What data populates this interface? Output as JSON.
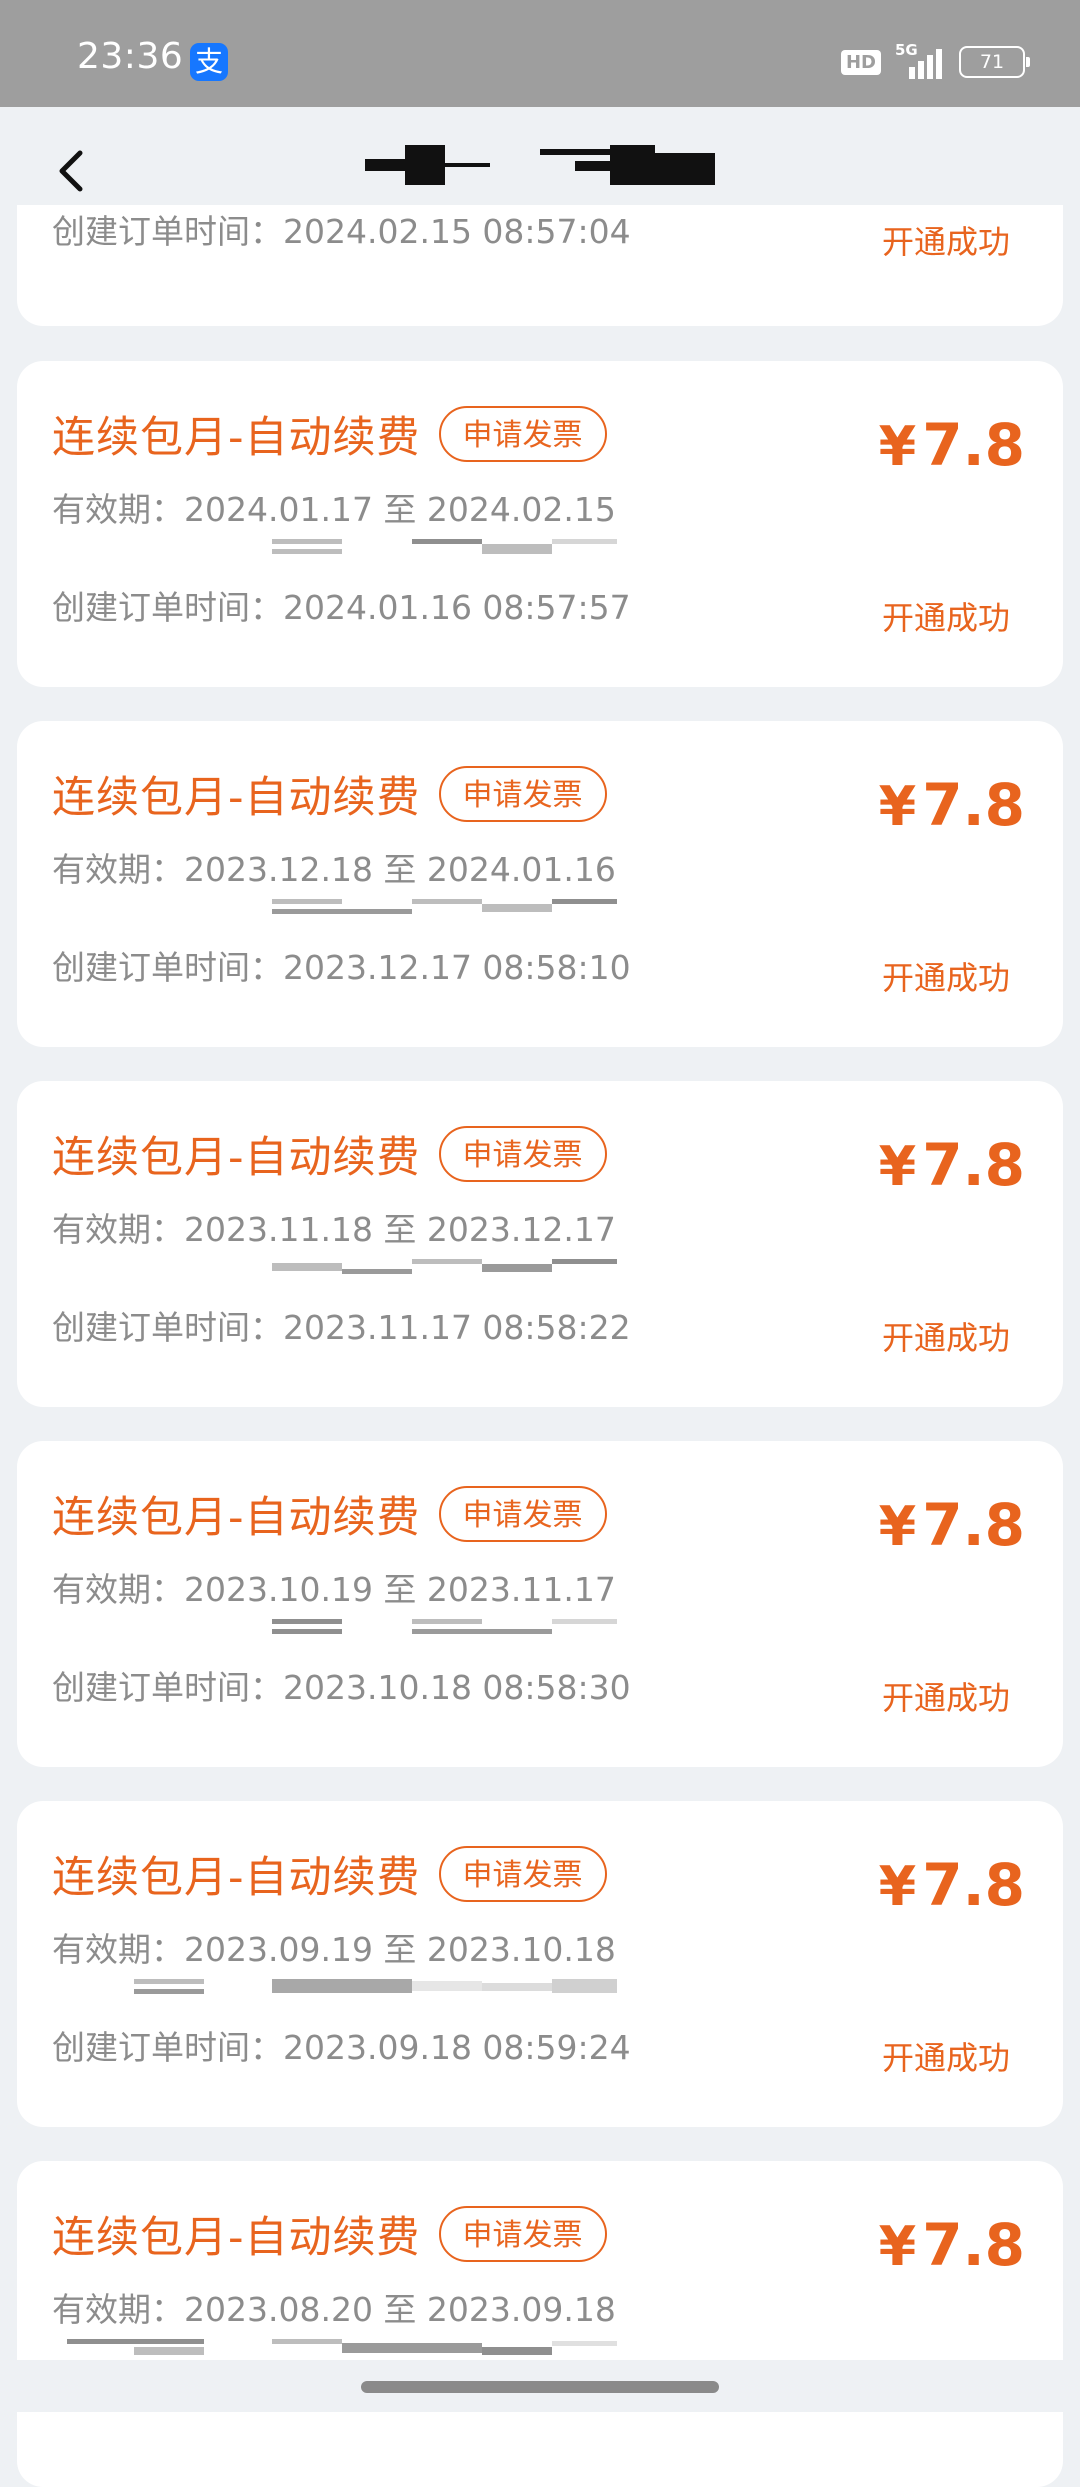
{
  "status_bar": {
    "time": "23:36",
    "app_badge": "支",
    "hd": "HD",
    "network": "5G",
    "battery": "71"
  },
  "header": {
    "back_icon": "chevron-left-icon"
  },
  "orders": [
    {
      "created_label": "创建订单时间：",
      "created": "2024.02.15 08:57:04",
      "status": "开通成功"
    },
    {
      "title": "连续包月-自动续费",
      "invoice_label": "申请发票",
      "price_symbol": "¥",
      "price": "7.8",
      "validity_label": "有效期：",
      "validity": "2024.01.17 至 2024.02.15",
      "created_label": "创建订单时间：",
      "created": "2024.01.16 08:57:57",
      "status": "开通成功"
    },
    {
      "title": "连续包月-自动续费",
      "invoice_label": "申请发票",
      "price_symbol": "¥",
      "price": "7.8",
      "validity_label": "有效期：",
      "validity": "2023.12.18 至 2024.01.16",
      "created_label": "创建订单时间：",
      "created": "2023.12.17 08:58:10",
      "status": "开通成功"
    },
    {
      "title": "连续包月-自动续费",
      "invoice_label": "申请发票",
      "price_symbol": "¥",
      "price": "7.8",
      "validity_label": "有效期：",
      "validity": "2023.11.18 至 2023.12.17",
      "created_label": "创建订单时间：",
      "created": "2023.11.17 08:58:22",
      "status": "开通成功"
    },
    {
      "title": "连续包月-自动续费",
      "invoice_label": "申请发票",
      "price_symbol": "¥",
      "price": "7.8",
      "validity_label": "有效期：",
      "validity": "2023.10.19 至 2023.11.17",
      "created_label": "创建订单时间：",
      "created": "2023.10.18 08:58:30",
      "status": "开通成功"
    },
    {
      "title": "连续包月-自动续费",
      "invoice_label": "申请发票",
      "price_symbol": "¥",
      "price": "7.8",
      "validity_label": "有效期：",
      "validity": "2023.09.19 至 2023.10.18",
      "created_label": "创建订单时间：",
      "created": "2023.09.18 08:59:24",
      "status": "开通成功"
    },
    {
      "title": "连续包月-自动续费",
      "invoice_label": "申请发票",
      "price_symbol": "¥",
      "price": "7.8",
      "validity_label": "有效期：",
      "validity": "2023.08.20 至 2023.09.18"
    }
  ],
  "colors": {
    "accent": "#e8641e",
    "background": "#eef1f4",
    "card": "#ffffff",
    "muted_text": "#8c8c8c"
  }
}
